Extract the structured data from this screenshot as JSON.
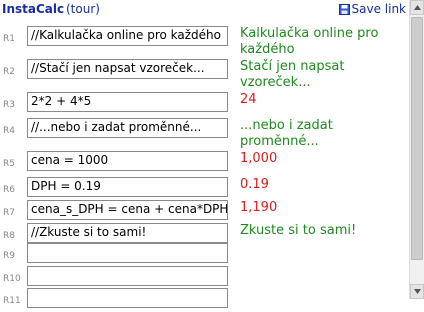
{
  "header": {
    "title": "InstaCalc",
    "tour_label": "(tour)",
    "save_label": "Save link"
  },
  "rows": [
    {
      "label": "R1",
      "input": "//Kalkulačka online pro každého",
      "result": "Kalkulačka online pro každého",
      "result_type": "comment"
    },
    {
      "label": "R2",
      "input": "//Stačí jen napsat vzoreček...",
      "result": "Stačí jen napsat vzoreček...",
      "result_type": "comment"
    },
    {
      "label": "R3",
      "input": "2*2 + 4*5",
      "result": "24",
      "result_type": "number"
    },
    {
      "label": "R4",
      "input": "//...nebo i zadat proměnné...",
      "result": "...nebo i zadat proměnné...",
      "result_type": "comment"
    },
    {
      "label": "R5",
      "input": "cena = 1000",
      "result": "1,000",
      "result_type": "number"
    },
    {
      "label": "R6",
      "input": "DPH = 0.19",
      "result": "0.19",
      "result_type": "number"
    },
    {
      "label": "R7",
      "input": "cena_s_DPH = cena + cena*DPH",
      "result": "1,190",
      "result_type": "number"
    },
    {
      "label": "R8",
      "input": "//Zkuste si to sami!",
      "result": "Zkuste si to sami!",
      "result_type": "comment"
    },
    {
      "label": "R9",
      "input": "",
      "result": "",
      "result_type": "empty"
    },
    {
      "label": "R10",
      "input": "",
      "result": "",
      "result_type": "empty"
    },
    {
      "label": "R11",
      "input": "",
      "result": "",
      "result_type": "empty"
    }
  ],
  "colors": {
    "link": "#1a2e9e",
    "comment_result": "#1f8a1f",
    "number_result": "#d42020"
  },
  "icons": {
    "save": "floppy-disk-icon"
  }
}
